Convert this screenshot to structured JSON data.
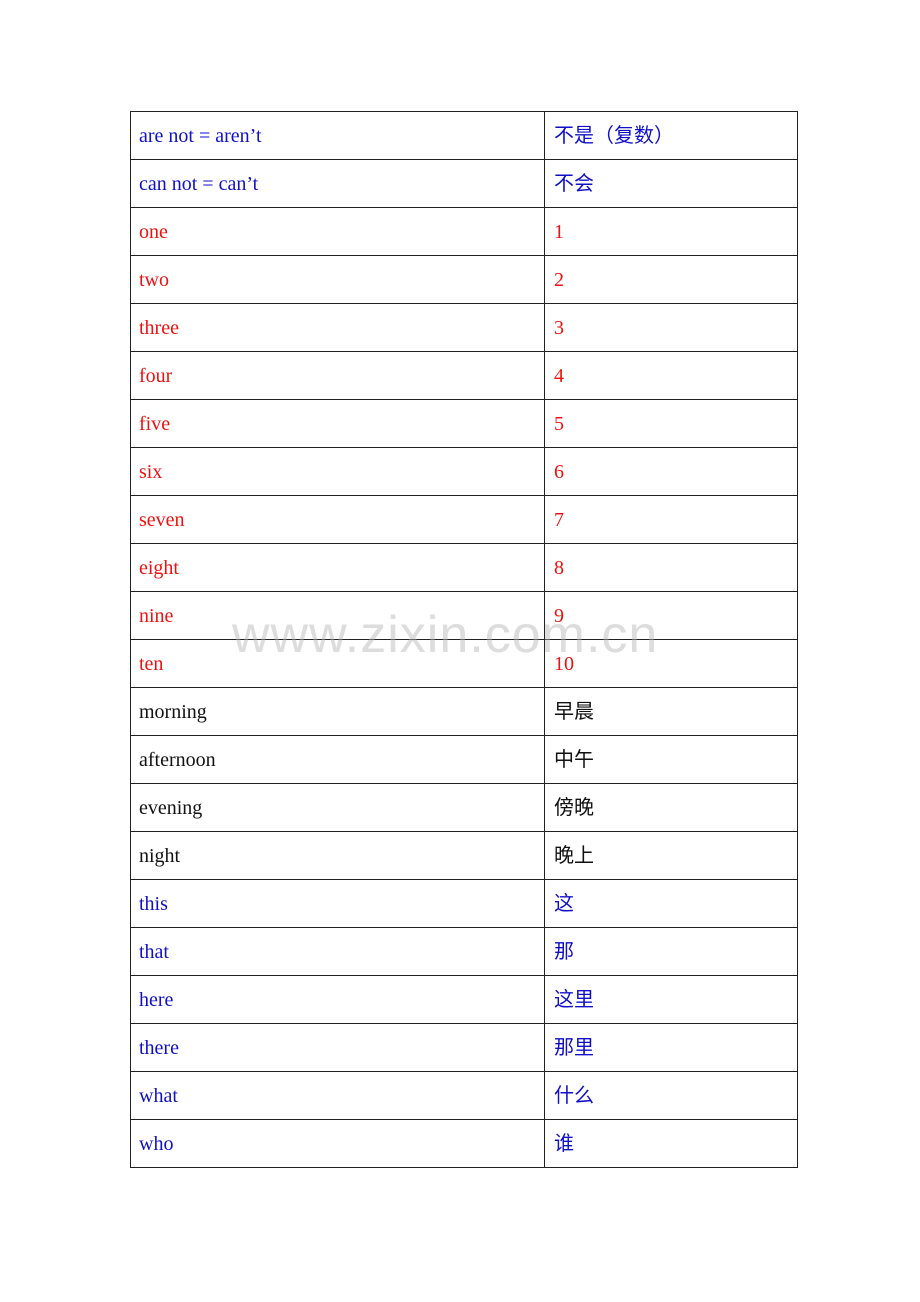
{
  "colors": {
    "blue": "#1010c8",
    "red": "#ee1111",
    "black": "#111111"
  },
  "watermark": "www.zixin.com.cn",
  "rows": [
    {
      "en": "are not = aren’t",
      "zh": "不是（复数）",
      "color": "blue"
    },
    {
      "en": "can not = can’t",
      "zh": "不会",
      "color": "blue"
    },
    {
      "en": "one",
      "zh": "1",
      "color": "red"
    },
    {
      "en": "two",
      "zh": "2",
      "color": "red"
    },
    {
      "en": "three",
      "zh": "3",
      "color": "red"
    },
    {
      "en": "four",
      "zh": "4",
      "color": "red"
    },
    {
      "en": "five",
      "zh": "5",
      "color": "red"
    },
    {
      "en": "six",
      "zh": "6",
      "color": "red"
    },
    {
      "en": "seven",
      "zh": "7",
      "color": "red"
    },
    {
      "en": "eight",
      "zh": "8",
      "color": "red"
    },
    {
      "en": "nine",
      "zh": "9",
      "color": "red"
    },
    {
      "en": "ten",
      "zh": "10",
      "color": "red"
    },
    {
      "en": "morning",
      "zh": "早晨",
      "color": "black"
    },
    {
      "en": "afternoon",
      "zh": "中午",
      "color": "black"
    },
    {
      "en": "evening",
      "zh": "傍晚",
      "color": "black"
    },
    {
      "en": "night",
      "zh": "晚上",
      "color": "black"
    },
    {
      "en": "this",
      "zh": "这",
      "color": "blue"
    },
    {
      "en": "that",
      "zh": "那",
      "color": "blue"
    },
    {
      "en": "here",
      "zh": "这里",
      "color": "blue"
    },
    {
      "en": "there",
      "zh": "那里",
      "color": "blue"
    },
    {
      "en": "what",
      "zh": "什么",
      "color": "blue"
    },
    {
      "en": "who",
      "zh": "谁",
      "color": "blue"
    }
  ]
}
